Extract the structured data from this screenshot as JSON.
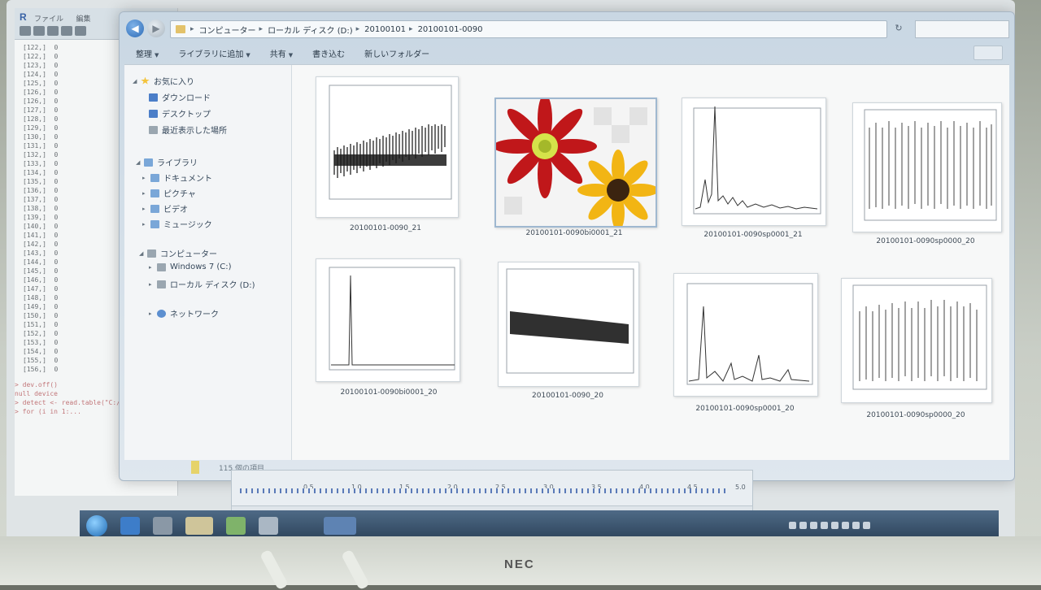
{
  "explorer": {
    "breadcrumb": [
      "コンピューター",
      "ローカル ディスク (D:)",
      "20100101",
      "20100101-0090"
    ],
    "toolbar": {
      "organize": "整理",
      "add_to_library": "ライブラリに追加",
      "share": "共有",
      "burn": "書き込む",
      "new_folder": "新しいフォルダー"
    },
    "nav": {
      "favorites": "お気に入り",
      "downloads": "ダウンロード",
      "desktop": "デスクトップ",
      "recent": "最近表示した場所",
      "libraries": "ライブラリ",
      "documents": "ドキュメント",
      "pictures": "ピクチャ",
      "videos": "ビデオ",
      "music": "ミュージック",
      "computer": "コンピューター",
      "drive_c": "Windows 7 (C:)",
      "drive_d": "ローカル ディスク (D:)",
      "network": "ネットワーク"
    },
    "files": [
      {
        "name": "20100101-0090_21"
      },
      {
        "name": "20100101-0090bi0001_21"
      },
      {
        "name": "20100101-0090sp0001_21"
      },
      {
        "name": "20100101-0090sp0000_20"
      },
      {
        "name": "20100101-0090bi0001_20"
      },
      {
        "name": "20100101-0090_20"
      },
      {
        "name": "20100101-0090sp0001_20"
      },
      {
        "name": "20100101-0090sp0000_20"
      }
    ],
    "status": "115 個の項目"
  },
  "rconsole": {
    "menu": [
      "ファイル",
      "編集"
    ],
    "lines": [
      "[122,]  0",
      "[122,]  0",
      "[123,]  0",
      "[124,]  0",
      "[125,]  0",
      "[126,]  0",
      "[126,]  0",
      "[127,]  0",
      "[128,]  0",
      "[129,]  0",
      "[130,]  0",
      "[131,]  0",
      "[132,]  0",
      "[133,]  0",
      "[134,]  0",
      "[135,]  0",
      "[136,]  0",
      "[137,]  0",
      "[138,]  0",
      "[139,]  0",
      "[140,]  0",
      "[141,]  0",
      "[142,]  0",
      "[143,]  0",
      "[144,]  0",
      "[145,]  0",
      "[146,]  0",
      "[147,]  0",
      "[148,]  0",
      "[149,]  0",
      "[150,]  0",
      "[151,]  0",
      "[152,]  0",
      "[153,]  0",
      "[154,]  0",
      "[155,]  0",
      "[156,]  0"
    ],
    "tail": [
      "> dev.off()",
      "null device",
      "> detect <- read.table(\"C:/Pr",
      "> for (i in 1:..."
    ]
  },
  "wave": {
    "ticks": [
      "0.5",
      "1.0",
      "1.5",
      "2.0",
      "2.5",
      "3.0",
      "3.5",
      "4.0",
      "4.5",
      "5.0"
    ]
  }
}
